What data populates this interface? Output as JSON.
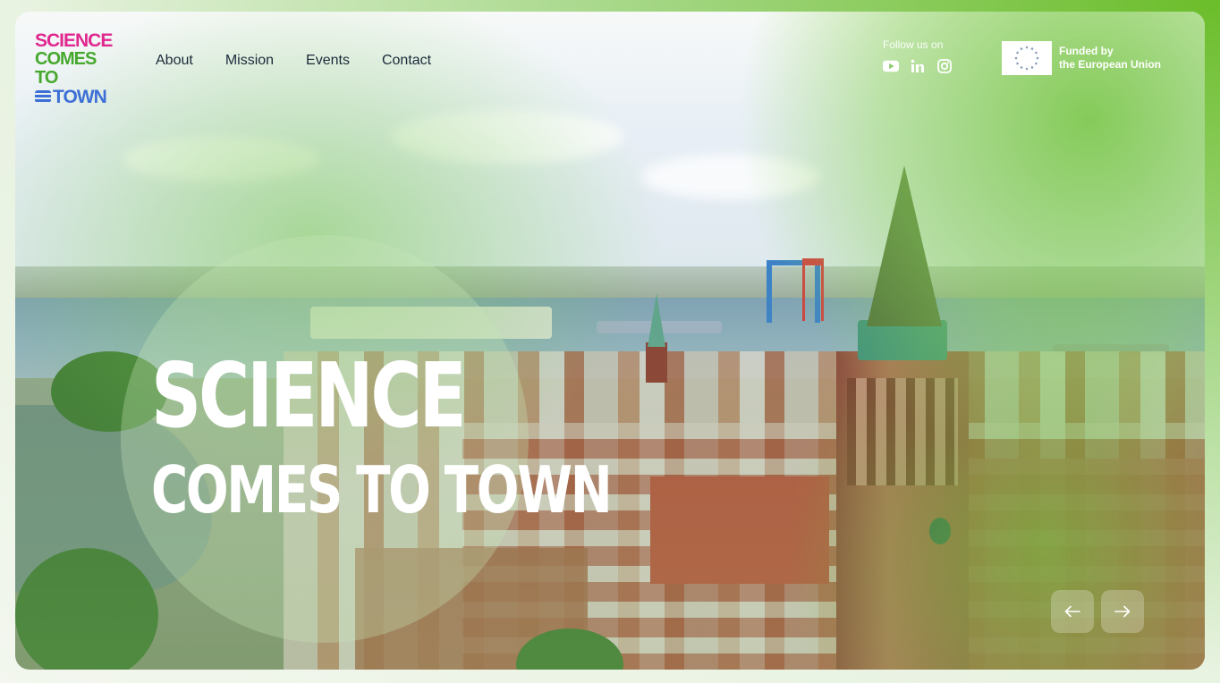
{
  "logo": {
    "line1": "SCIENCE",
    "line2": "COMES TO",
    "line3": "TOWN",
    "colors": {
      "line1": "#e0288f",
      "line2": "#47a82e",
      "line3": "#3d6fd6"
    }
  },
  "nav": {
    "items": [
      {
        "label": "About"
      },
      {
        "label": "Mission"
      },
      {
        "label": "Events"
      },
      {
        "label": "Contact"
      }
    ]
  },
  "social": {
    "label": "Follow us on",
    "icons": [
      "youtube-icon",
      "linkedin-icon",
      "instagram-icon"
    ]
  },
  "eu": {
    "line1": "Funded by",
    "line2": "the European Union",
    "flag_icon": "eu-stars-icon"
  },
  "hero": {
    "line1": "SCIENCE",
    "line2": "COMES TO TOWN"
  },
  "carousel": {
    "prev_icon": "arrow-left-icon",
    "next_icon": "arrow-right-icon"
  },
  "colors": {
    "accent_green": "#6bbd2a",
    "nav_text": "#1b2a3a",
    "hero_text": "#ffffff"
  }
}
